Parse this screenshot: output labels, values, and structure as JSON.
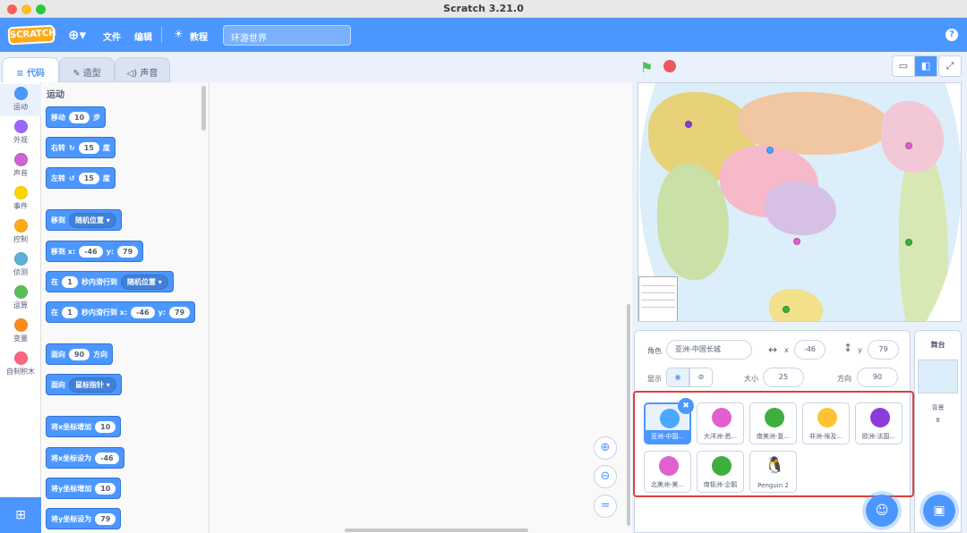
{
  "window": {
    "title": "Scratch 3.21.0"
  },
  "menu": {
    "logo": "SCRATCH",
    "file": "文件",
    "edit": "编辑",
    "tutorials": "教程",
    "project_name": "环游世界",
    "help": "?"
  },
  "tabs": {
    "code": "代码",
    "costumes": "造型",
    "sounds": "声音"
  },
  "categories": [
    {
      "label": "运动",
      "color": "#4c97ff"
    },
    {
      "label": "外观",
      "color": "#9966ff"
    },
    {
      "label": "声音",
      "color": "#cf63cf"
    },
    {
      "label": "事件",
      "color": "#ffd500"
    },
    {
      "label": "控制",
      "color": "#ffab19"
    },
    {
      "label": "侦测",
      "color": "#5cb1d6"
    },
    {
      "label": "运算",
      "color": "#59c059"
    },
    {
      "label": "变量",
      "color": "#ff8c1a"
    },
    {
      "label": "自制积木",
      "color": "#ff6680"
    }
  ],
  "palette": {
    "heading": "运动",
    "move": {
      "t1": "移动",
      "v": "10",
      "t2": "步"
    },
    "turn_right": {
      "t1": "右转",
      "v": "15",
      "t2": "度"
    },
    "turn_left": {
      "t1": "左转",
      "v": "15",
      "t2": "度"
    },
    "goto": {
      "t1": "移到",
      "d": "随机位置"
    },
    "goto_xy": {
      "t1": "移到 x:",
      "x": "-46",
      "t2": "y:",
      "y": "79"
    },
    "glide": {
      "t1": "在",
      "v": "1",
      "t2": "秒内滑行到",
      "d": "随机位置"
    },
    "glide_xy": {
      "t1": "在",
      "v": "1",
      "t2": "秒内滑行到 x:",
      "x": "-46",
      "t3": "y:",
      "y": "79"
    },
    "point": {
      "t1": "面向",
      "v": "90",
      "t2": "方向"
    },
    "point_to": {
      "t1": "面向",
      "d": "鼠标指针"
    },
    "change_x": {
      "t1": "将x坐标增加",
      "v": "10"
    },
    "set_x": {
      "t1": "将x坐标设为",
      "v": "-46"
    },
    "change_y": {
      "t1": "将y坐标增加",
      "v": "10"
    },
    "set_y": {
      "t1": "将y坐标设为",
      "v": "79"
    }
  },
  "sprite_info": {
    "sprite_label": "角色",
    "sprite_name": "亚洲-中国长城",
    "x_label": "x",
    "x": "-46",
    "y_label": "y",
    "y": "79",
    "show_label": "显示",
    "size_label": "大小",
    "size": "25",
    "direction_label": "方向",
    "direction": "90"
  },
  "sprites": [
    {
      "name": "亚洲-中国...",
      "color": "#4aa8ff"
    },
    {
      "name": "大洋洲-悉...",
      "color": "#e060d0"
    },
    {
      "name": "南美洲-复...",
      "color": "#3fae3f"
    },
    {
      "name": "非洲-埃及...",
      "color": "#ffc233"
    },
    {
      "name": "欧洲-法国...",
      "color": "#8a3cd8"
    },
    {
      "name": "北美洲-美...",
      "color": "#e060d0"
    },
    {
      "name": "南极洲-企鹅",
      "color": "#3fae3f"
    },
    {
      "name": "Penguin 2",
      "color": "#222222"
    }
  ],
  "stage_panel": {
    "title": "舞台",
    "backdrop_label": "背景",
    "backdrop_count": "8"
  }
}
